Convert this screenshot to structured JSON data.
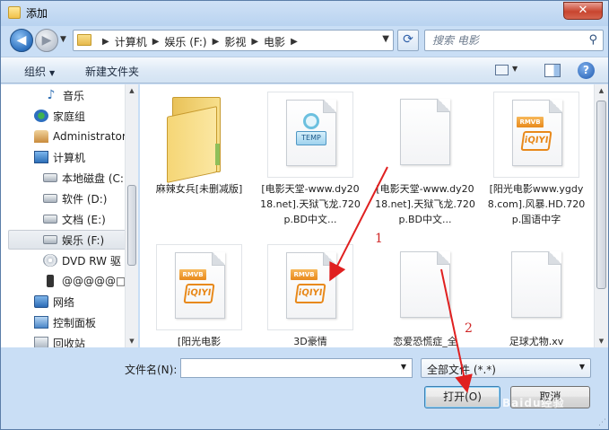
{
  "window": {
    "title": "添加",
    "close_label": "✕"
  },
  "nav": {
    "back_glyph": "◀",
    "forward_glyph": "▶",
    "recent_glyph": "▼",
    "breadcrumb": [
      "计算机",
      "娱乐 (F:)",
      "影视",
      "电影"
    ],
    "separator": "▶",
    "address_drop": "▼",
    "refresh_glyph": "⟳",
    "search_placeholder": "搜索 电影",
    "search_icon_glyph": "⚲"
  },
  "toolbar": {
    "organize_label": "组织",
    "organize_arrow": "▼",
    "new_folder_label": "新建文件夹",
    "view_arrow": "▼",
    "help_glyph": "?"
  },
  "tree": [
    {
      "label": "音乐",
      "icon": "music-icon"
    },
    {
      "label": "家庭组",
      "icon": "homegroup-icon"
    },
    {
      "label": "Administrator",
      "icon": "user-folder-icon"
    },
    {
      "label": "计算机",
      "icon": "computer-icon"
    },
    {
      "label": "本地磁盘 (C:",
      "icon": "drive-icon"
    },
    {
      "label": "软件 (D:)",
      "icon": "drive-icon"
    },
    {
      "label": "文档 (E:)",
      "icon": "drive-icon"
    },
    {
      "label": "娱乐 (F:)",
      "icon": "drive-icon",
      "selected": true
    },
    {
      "label": "DVD RW 驱",
      "icon": "dvd-icon"
    },
    {
      "label": "@@@@@□",
      "icon": "phone-icon"
    },
    {
      "label": "网络",
      "icon": "network-icon"
    },
    {
      "label": "控制面板",
      "icon": "control-panel-icon"
    },
    {
      "label": "回收站",
      "icon": "recycle-bin-icon"
    }
  ],
  "files": [
    {
      "name": "麻辣女兵[未删减版]",
      "type": "folder"
    },
    {
      "name": "[电影天堂-www.dy2018.net].天狱飞龙.720p.BD中文...",
      "type": "temp",
      "badge": "TEMP"
    },
    {
      "name": "[电影天堂-www.dy2018.net].天狱飞龙.720p.BD中文...",
      "type": "blank"
    },
    {
      "name": "[阳光电影www.ygdy8.com].风暴.HD.720p.国语中字",
      "type": "rmvb",
      "badge": "RMVB",
      "logo": "iQIYI"
    },
    {
      "name": "[阳光电影",
      "type": "rmvb",
      "badge": "RMVB",
      "logo": "iQIYI"
    },
    {
      "name": "3D豪情",
      "type": "rmvb",
      "badge": "RMVB",
      "logo": "iQIYI"
    },
    {
      "name": "恋爱恐慌症_全",
      "type": "blank"
    },
    {
      "name": "足球尤物.xv",
      "type": "blank"
    }
  ],
  "footer": {
    "filename_label": "文件名(N):",
    "filename_value": "",
    "filename_drop": "▼",
    "filetype_value": "全部文件 (*.*)",
    "filetype_drop": "▼",
    "open_label": "打开(O)",
    "cancel_label": "取消"
  },
  "annotations": {
    "step1": "1",
    "step2": "2",
    "color": "#e02020"
  },
  "watermark": "Baidu经验",
  "colors": {
    "accent": "#3c7fb1",
    "title_bar": "#c9def5",
    "selection": "#dfe4ea"
  }
}
